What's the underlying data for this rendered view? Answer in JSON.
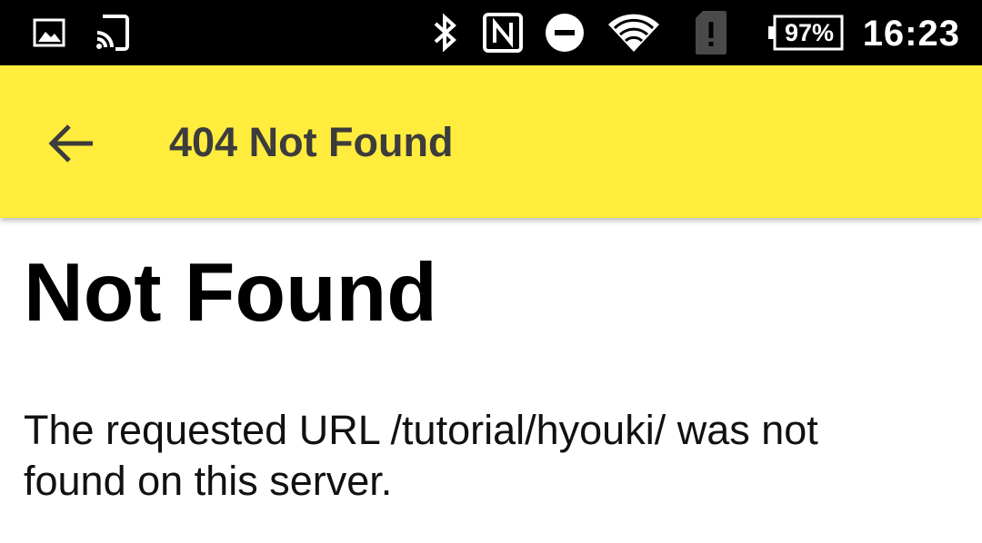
{
  "status_bar": {
    "battery_percent": "97%",
    "time": "16:23",
    "icons": [
      "image-notification-icon",
      "cast-icon",
      "bluetooth-icon",
      "nfc-icon",
      "do-not-disturb-icon",
      "wifi-icon",
      "sim-alert-icon",
      "battery-icon"
    ]
  },
  "app_bar": {
    "title": "404 Not Found",
    "background_color": "#ffec3d",
    "back_icon": "arrow-left-icon"
  },
  "page": {
    "heading": "Not Found",
    "message": "The requested URL /tutorial/hyouki/ was not found on this server."
  }
}
